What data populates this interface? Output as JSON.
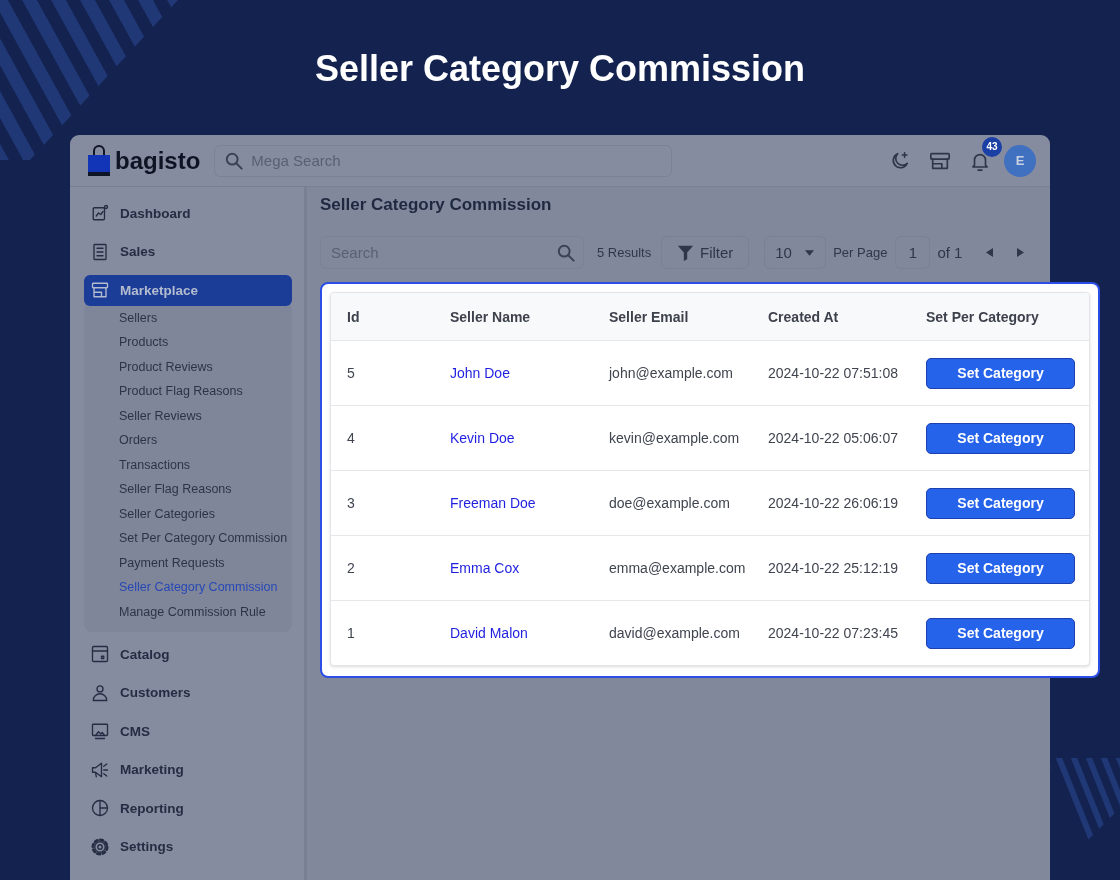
{
  "page_title": "Seller Category Commission",
  "header": {
    "logo": "bagisto",
    "search": {
      "placeholder": "Mega Search"
    },
    "notifications": "43",
    "avatar": "E"
  },
  "sidebar": {
    "items": [
      {
        "label": "Dashboard",
        "selected": false
      },
      {
        "label": "Sales",
        "selected": false
      },
      {
        "label": "Marketplace",
        "selected": true,
        "children": [
          {
            "label": "Sellers",
            "selected": false
          },
          {
            "label": "Products",
            "selected": false
          },
          {
            "label": "Product Reviews",
            "selected": false
          },
          {
            "label": "Product Flag Reasons",
            "selected": false
          },
          {
            "label": "Seller Reviews",
            "selected": false
          },
          {
            "label": "Orders",
            "selected": false
          },
          {
            "label": "Transactions",
            "selected": false
          },
          {
            "label": "Seller Flag Reasons",
            "selected": false
          },
          {
            "label": "Seller Categories",
            "selected": false
          },
          {
            "label": "Set Per Category Commission",
            "selected": false
          },
          {
            "label": "Payment Requests",
            "selected": false
          },
          {
            "label": "Seller Category Commission",
            "selected": true
          },
          {
            "label": "Manage Commission Rule",
            "selected": false
          }
        ]
      },
      {
        "label": "Catalog",
        "selected": false
      },
      {
        "label": "Customers",
        "selected": false
      },
      {
        "label": "CMS",
        "selected": false
      },
      {
        "label": "Marketing",
        "selected": false
      },
      {
        "label": "Reporting",
        "selected": false
      },
      {
        "label": "Settings",
        "selected": false
      }
    ]
  },
  "main": {
    "title": "Seller Category Commission",
    "toolbar": {
      "search": {
        "placeholder": "Search"
      },
      "results": "5 Results",
      "filter": "Filter",
      "per_page": "10",
      "per_page_label": "Per Page",
      "page": "1",
      "page_total": "of 1"
    },
    "table": {
      "highlighted": true,
      "columns": [
        "Id",
        "Seller Name",
        "Seller Email",
        "Created At",
        "Set Per Category"
      ],
      "rows": [
        {
          "id": "5",
          "seller_name": "John Doe",
          "seller_email": "john@example.com",
          "created_at": "2024-10-22 07:51:08",
          "action": "Set Category"
        },
        {
          "id": "4",
          "seller_name": "Kevin Doe",
          "seller_email": "kevin@example.com",
          "created_at": "2024-10-22 05:06:07",
          "action": "Set Category"
        },
        {
          "id": "3",
          "seller_name": "Freeman Doe",
          "seller_email": "doe@example.com",
          "created_at": "2024-10-22 26:06:19",
          "action": "Set Category"
        },
        {
          "id": "2",
          "seller_name": "Emma Cox",
          "seller_email": "emma@example.com",
          "created_at": "2024-10-22 25:12:19",
          "action": "Set Category"
        },
        {
          "id": "1",
          "seller_name": "David Malon",
          "seller_email": "david@example.com",
          "created_at": "2024-10-22 07:23:45",
          "action": "Set Category"
        }
      ]
    }
  }
}
